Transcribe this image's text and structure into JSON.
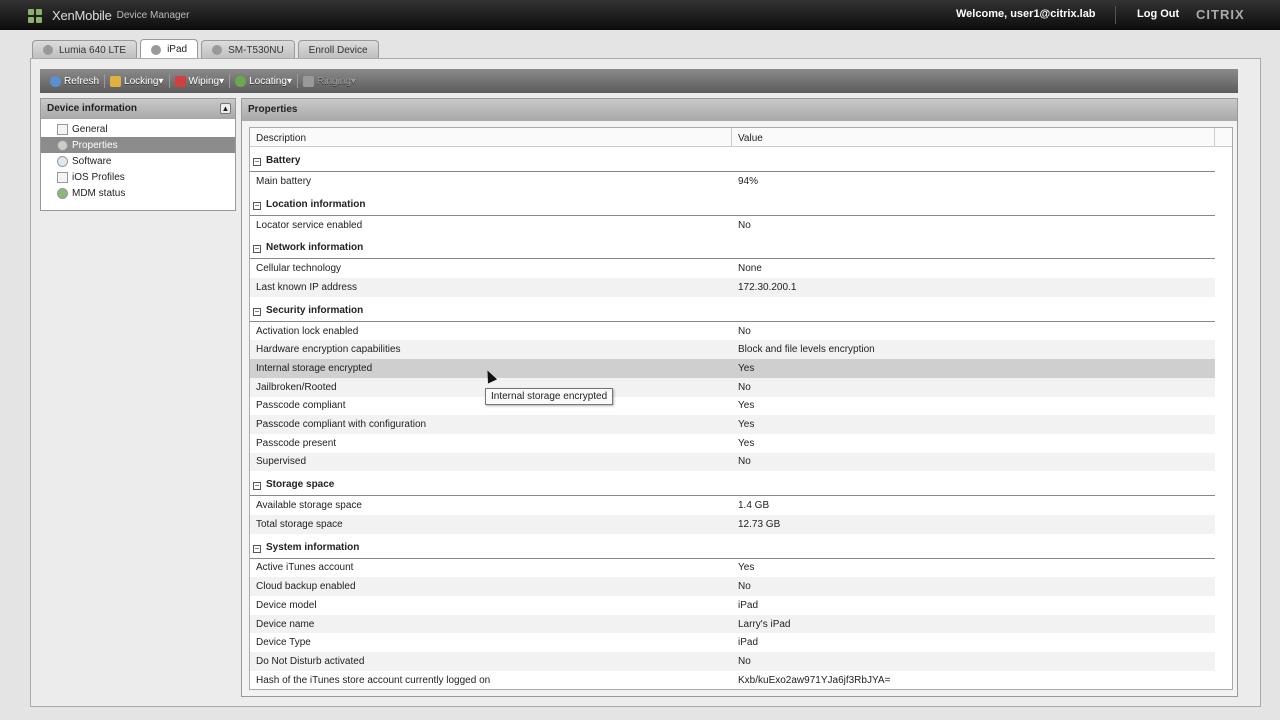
{
  "app": {
    "brand": "XenMobile",
    "subtitle": "Device Manager",
    "welcome": "Welcome, user1@citrix.lab",
    "logout": "Log Out",
    "vendor": "CITRIX"
  },
  "tabs": [
    {
      "label": "Lumia 640 LTE"
    },
    {
      "label": "iPad"
    },
    {
      "label": "SM-T530NU"
    },
    {
      "label": "Enroll Device"
    }
  ],
  "toolbar": {
    "refresh": "Refresh",
    "locking": "Locking",
    "wiping": "Wiping",
    "locating": "Locating",
    "ringing": "Ringing"
  },
  "sidebar": {
    "title": "Device information",
    "items": [
      {
        "label": "General"
      },
      {
        "label": "Properties"
      },
      {
        "label": "Software"
      },
      {
        "label": "iOS Profiles"
      },
      {
        "label": "MDM status"
      }
    ]
  },
  "main": {
    "title": "Properties",
    "col_desc": "Description",
    "col_value": "Value",
    "groups": [
      {
        "name": "Battery",
        "rows": [
          [
            "Main battery",
            "94%"
          ]
        ]
      },
      {
        "name": "Location information",
        "rows": [
          [
            "Locator service enabled",
            "No"
          ]
        ]
      },
      {
        "name": "Network information",
        "rows": [
          [
            "Cellular technology",
            "None"
          ],
          [
            "Last known IP address",
            "172.30.200.1"
          ]
        ]
      },
      {
        "name": "Security information",
        "rows": [
          [
            "Activation lock enabled",
            "No"
          ],
          [
            "Hardware encryption capabilities",
            "Block and file levels encryption"
          ],
          [
            "Internal storage encrypted",
            "Yes"
          ],
          [
            "Jailbroken/Rooted",
            "No"
          ],
          [
            "Passcode compliant",
            "Yes"
          ],
          [
            "Passcode compliant with configuration",
            "Yes"
          ],
          [
            "Passcode present",
            "Yes"
          ],
          [
            "Supervised",
            "No"
          ]
        ]
      },
      {
        "name": "Storage space",
        "rows": [
          [
            "Available storage space",
            "1.4 GB"
          ],
          [
            "Total storage space",
            "12.73 GB"
          ]
        ]
      },
      {
        "name": "System information",
        "rows": [
          [
            "Active iTunes account",
            "Yes"
          ],
          [
            "Cloud backup enabled",
            "No"
          ],
          [
            "Device model",
            "iPad"
          ],
          [
            "Device name",
            "Larry's iPad"
          ],
          [
            "Device Type",
            "iPad"
          ],
          [
            "Do Not Disturb activated",
            "No"
          ],
          [
            "Hash of the iTunes store account currently logged on",
            "Kxb/kuExo2aw971YJa6jf3RbJYA="
          ]
        ]
      }
    ],
    "tooltip": "Internal storage encrypted"
  }
}
